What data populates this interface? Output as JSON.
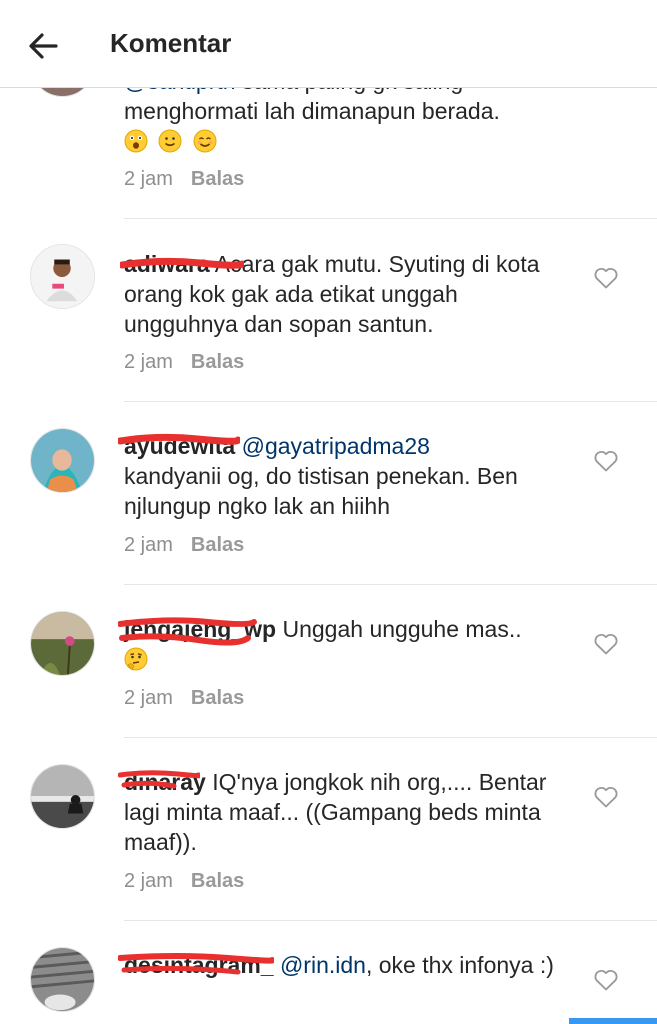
{
  "header": {
    "title": "Komentar",
    "back_icon": "arrow-left-icon"
  },
  "colors": {
    "mention": "#003569",
    "meta": "#8e8e8e",
    "redaction": "#e8312f",
    "accent": "#3897f0"
  },
  "comments": [
    {
      "username": "",
      "mention": "@santiprtn",
      "text_partial": "sama paling gk saling",
      "text": "menghormati lah dimanapun berada.",
      "emojis": [
        "astonished-face-icon",
        "slightly-smiling-face-icon",
        "smiling-face-icon"
      ],
      "time": "2 jam",
      "reply": "Balas"
    },
    {
      "username": "adiwara",
      "text": "Acara gak mutu. Syuting di kota orang kok gak ada etikat unggah ungguhnya dan sopan santun.",
      "time": "2 jam",
      "reply": "Balas"
    },
    {
      "username": "ayudewita",
      "mention": "@gayatripadma28",
      "text": "kandyanii og, do tistisan penekan. Ben njlungup ngko lak an hiihh",
      "time": "2 jam",
      "reply": "Balas"
    },
    {
      "username": "jengajeng_wp",
      "text": "Unggah ungguhe mas..",
      "emojis": [
        "thinking-face-icon"
      ],
      "time": "2 jam",
      "reply": "Balas"
    },
    {
      "username": "dinaray",
      "text": "IQ'nya jongkok nih org,.... Bentar lagi minta maaf... ((Gampang beds minta maaf)).",
      "time": "2 jam",
      "reply": "Balas"
    },
    {
      "username": "desintagram_",
      "mention": "@rin.idn",
      "text": ", oke thx infonya :)",
      "time": "",
      "reply": ""
    }
  ]
}
